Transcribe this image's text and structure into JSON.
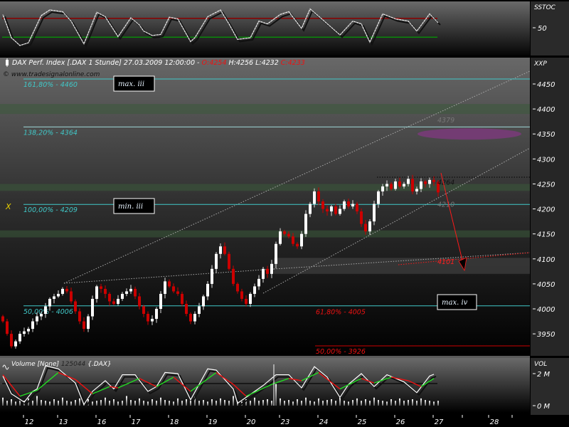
{
  "header": {
    "instrument": "DAX Perf. Index [.DAX  1 Stunde] 27.03.2009 12:00:00 -",
    "open": "O:4254",
    "high": "H:4256",
    "low": "L:4232",
    "close": "C:4233",
    "copyright": "© www.tradesignalonline.com"
  },
  "colors": {
    "up": "#ffffff",
    "down": "#cc0000",
    "fib": "#40c8c8",
    "red": "#ff1a1a",
    "band": "#3a5a3a",
    "ellipse": "#7a3a7a"
  },
  "chart_data": [
    {
      "type": "line",
      "pane": "top",
      "axis_label": "SSTOC",
      "ticks": [
        50
      ],
      "ylim": [
        0,
        100
      ],
      "levels": [
        67,
        33
      ],
      "series": [
        {
          "points": [
            [
              0,
              74
            ],
            [
              2,
              32
            ],
            [
              4,
              18
            ],
            [
              6,
              23
            ],
            [
              9,
              72
            ],
            [
              11,
              82
            ],
            [
              14,
              79
            ],
            [
              16,
              62
            ],
            [
              19,
              21
            ],
            [
              22,
              78
            ],
            [
              24,
              70
            ],
            [
              27,
              34
            ],
            [
              30,
              68
            ],
            [
              32,
              55
            ],
            [
              33,
              44
            ],
            [
              35,
              36
            ],
            [
              37,
              38
            ],
            [
              39,
              69
            ],
            [
              41,
              66
            ],
            [
              44,
              25
            ],
            [
              45,
              32
            ],
            [
              48,
              70
            ],
            [
              51,
              82
            ],
            [
              53,
              57
            ],
            [
              55,
              29
            ],
            [
              58,
              32
            ],
            [
              60,
              62
            ],
            [
              62,
              57
            ],
            [
              65,
              74
            ],
            [
              67,
              79
            ],
            [
              70,
              49
            ],
            [
              72,
              84
            ],
            [
              75,
              64
            ],
            [
              79,
              37
            ],
            [
              82,
              62
            ],
            [
              84,
              57
            ],
            [
              86,
              24
            ],
            [
              89,
              75
            ],
            [
              92,
              66
            ],
            [
              95,
              62
            ],
            [
              97,
              44
            ],
            [
              100,
              75
            ],
            [
              102,
              59
            ]
          ]
        }
      ]
    },
    {
      "type": "candlestick",
      "pane": "main",
      "axis_label": "XXP",
      "ticks": [
        3950,
        4000,
        4050,
        4100,
        4150,
        4200,
        4250,
        4300,
        4350,
        4400,
        4450
      ],
      "ylim": [
        3900,
        4500
      ],
      "first_open": 3985,
      "closes": [
        3975,
        3950,
        3925,
        3935,
        3950,
        3955,
        3960,
        3975,
        3985,
        3990,
        4005,
        4020,
        4025,
        4030,
        4040,
        4035,
        4015,
        3995,
        3975,
        3960,
        3985,
        4020,
        4045,
        4040,
        4030,
        4015,
        4010,
        4020,
        4030,
        4035,
        4040,
        4025,
        4005,
        3990,
        3975,
        3980,
        4000,
        4030,
        4055,
        4045,
        4035,
        4030,
        4010,
        3990,
        3975,
        3990,
        4005,
        4025,
        4050,
        4080,
        4110,
        4125,
        4110,
        4080,
        4050,
        4035,
        4020,
        4010,
        4030,
        4045,
        4060,
        4080,
        4070,
        4090,
        4130,
        4155,
        4150,
        4145,
        4130,
        4125,
        4150,
        4190,
        4210,
        4235,
        4215,
        4200,
        4195,
        4205,
        4190,
        4200,
        4215,
        4205,
        4210,
        4195,
        4170,
        4155,
        4175,
        4210,
        4235,
        4245,
        4250,
        4240,
        4255,
        4245,
        4250,
        4260,
        4235,
        4240,
        4255,
        4250,
        4258,
        4254,
        4233
      ],
      "fib_levels": [
        {
          "label": "161,80% - 4460",
          "value": 4460,
          "color": "#40c8c8"
        },
        {
          "label": "138,20% - 4364",
          "value": 4364,
          "color": "#9fd8d8"
        },
        {
          "label": "100,00% - 4209",
          "value": 4209,
          "color": "#40c8c8"
        },
        {
          "label": "50,00% - 4006",
          "value": 4006,
          "color": "#40c8c8"
        }
      ],
      "red_levels": [
        {
          "label": "61,80% - 4005",
          "value": 4005
        },
        {
          "label": "50,00% - 3926",
          "value": 3926
        }
      ],
      "zones": [
        [
          4390,
          4410
        ],
        [
          4236,
          4250
        ],
        [
          4143,
          4157
        ]
      ],
      "price_marks": [
        {
          "label": "4379",
          "value": 4379,
          "color": "#777777"
        },
        {
          "label": "4264",
          "value": 4264,
          "color": "#111111"
        },
        {
          "label": "4210",
          "value": 4210,
          "color": "#777777"
        },
        {
          "label": "4101",
          "value": 4101,
          "color": "#ff2020"
        }
      ],
      "wave_labels": [
        {
          "label": "max. iii",
          "value": 4460
        },
        {
          "label": "min. iii",
          "value": 4209
        },
        {
          "label": "max. iv",
          "value": 4006
        }
      ],
      "marker": "X",
      "target_arrow": {
        "from": 4272,
        "to": 4080
      }
    },
    {
      "type": "line",
      "pane": "volume",
      "title": "Volume [None]",
      "value_label": "125044",
      "symbol": "{.DAX}",
      "axis_label": "VOL",
      "ticks": [
        "2 M",
        "0 M"
      ],
      "ylim": [
        0,
        2.8
      ],
      "reference_level": 1.38,
      "series": [
        {
          "color": "#ffffff",
          "points": [
            [
              0,
              1.85
            ],
            [
              2,
              0.74
            ],
            [
              5,
              0.22
            ],
            [
              7,
              0.89
            ],
            [
              8,
              1.04
            ],
            [
              10,
              2.49
            ],
            [
              13,
              2.3
            ],
            [
              17,
              1.41
            ],
            [
              19,
              0.07
            ],
            [
              21,
              0.89
            ],
            [
              24,
              1.56
            ],
            [
              26,
              1.04
            ],
            [
              28,
              1.93
            ],
            [
              31,
              1.93
            ],
            [
              34,
              0.89
            ],
            [
              36,
              1.19
            ],
            [
              38,
              2.07
            ],
            [
              41,
              2.0
            ],
            [
              44,
              0.37
            ],
            [
              48,
              2.3
            ],
            [
              50,
              2.22
            ],
            [
              54,
              1.04
            ],
            [
              55,
              0.15
            ],
            [
              59,
              0.89
            ],
            [
              61,
              1.26
            ],
            [
              64,
              1.93
            ],
            [
              67,
              1.93
            ],
            [
              70,
              1.11
            ],
            [
              73,
              2.44
            ],
            [
              76,
              1.78
            ],
            [
              79,
              0.52
            ],
            [
              81,
              1.33
            ],
            [
              84,
              2.0
            ],
            [
              87,
              1.19
            ],
            [
              90,
              1.93
            ],
            [
              94,
              1.48
            ],
            [
              97,
              0.81
            ],
            [
              100,
              1.85
            ],
            [
              101,
              1.96
            ]
          ]
        },
        {
          "color": "green/red",
          "points": [
            [
              0,
              1.93
            ],
            [
              4,
              0.59
            ],
            [
              8,
              0.96
            ],
            [
              13,
              2.07
            ],
            [
              17,
              1.63
            ],
            [
              21,
              0.74
            ],
            [
              25,
              1.19
            ],
            [
              27,
              1.11
            ],
            [
              32,
              1.7
            ],
            [
              36,
              1.19
            ],
            [
              40,
              1.78
            ],
            [
              44,
              0.89
            ],
            [
              50,
              2.07
            ],
            [
              54,
              1.33
            ],
            [
              57,
              0.59
            ],
            [
              63,
              1.33
            ],
            [
              67,
              1.7
            ],
            [
              70,
              1.56
            ],
            [
              74,
              2.07
            ],
            [
              79,
              1.04
            ],
            [
              84,
              1.7
            ],
            [
              87,
              1.41
            ],
            [
              91,
              1.78
            ],
            [
              95,
              1.56
            ],
            [
              98,
              1.19
            ],
            [
              101,
              1.7
            ]
          ]
        }
      ],
      "volume_bars": [
        0.5,
        0.3,
        0.4,
        0.25,
        0.35,
        0.3,
        0.45,
        0.3,
        0.6,
        0.35,
        0.3,
        0.25,
        0.4,
        0.3,
        0.5,
        0.3,
        0.25,
        0.35,
        0.45,
        0.3,
        0.4,
        0.25,
        0.3,
        0.35,
        0.5,
        0.3,
        0.4,
        0.25,
        0.3,
        0.6,
        0.35,
        0.3,
        0.45,
        0.3,
        0.25,
        0.4,
        0.3,
        0.5,
        0.35,
        0.3,
        0.25,
        0.45,
        0.3,
        0.4,
        0.3,
        0.55,
        0.3,
        0.35,
        0.25,
        0.4,
        0.3,
        0.45,
        0.35,
        0.3,
        0.6,
        0.3,
        0.25,
        0.4,
        0.3,
        0.5,
        0.3,
        0.35,
        0.4,
        0.3,
        1.4,
        0.45,
        0.3,
        0.35,
        0.25,
        0.4,
        0.3,
        0.5,
        0.3,
        0.25,
        0.45,
        0.3,
        0.35,
        0.4,
        0.3,
        0.5,
        0.3,
        0.25,
        0.35,
        0.45,
        0.3,
        0.4,
        0.3,
        0.5,
        0.35,
        0.3,
        0.25,
        0.4,
        0.3,
        0.45,
        0.3,
        0.35,
        0.4,
        0.3,
        0.45,
        0.35,
        0.3,
        0.25,
        0.3
      ]
    }
  ],
  "x_axis": {
    "labels": [
      [
        "12",
        5
      ],
      [
        "13",
        13
      ],
      [
        "16",
        22
      ],
      [
        "17",
        30
      ],
      [
        "18",
        39
      ],
      [
        "19",
        48
      ],
      [
        "20",
        57
      ],
      [
        "23",
        65
      ],
      [
        "24",
        74
      ],
      [
        "25",
        83
      ],
      [
        "26",
        92
      ],
      [
        "27",
        101
      ],
      [
        "28",
        114
      ]
    ]
  }
}
